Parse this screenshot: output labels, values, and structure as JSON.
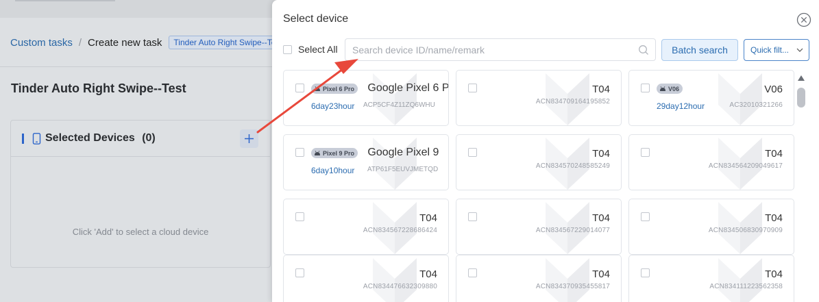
{
  "breadcrumb": {
    "parent": "Custom tasks",
    "separator": "/",
    "current": "Create new task",
    "tag": "Tinder Auto Right Swipe--Te"
  },
  "task": {
    "title": "Tinder Auto Right Swipe--Test"
  },
  "panel": {
    "title": "Selected Devices",
    "count": "(0)",
    "empty_text": "Click 'Add' to select a cloud device"
  },
  "dialog": {
    "title": "Select device",
    "select_all": "Select All",
    "search_placeholder": "Search device ID/name/remark",
    "search_value": "",
    "batch_search": "Batch search",
    "quick_filter": "Quick filt..."
  },
  "devices": [
    {
      "badge": "Pixel 6 Pro",
      "model": "Google Pixel 6 P",
      "uptime": "6day23hour",
      "serial": "ACP5CF4Z11ZQ6WHU"
    },
    {
      "model": "T04",
      "serial": "ACN834709164195852"
    },
    {
      "badge": "V06",
      "model": "V06",
      "uptime": "29day12hour",
      "serial": "AC32010321266"
    },
    {
      "badge": "Pixel 9 Pro",
      "model": "Google Pixel 9",
      "uptime": "6day10hour",
      "serial": "ATP61F5EUVJMETQD"
    },
    {
      "model": "T04",
      "serial": "ACN834570248585249"
    },
    {
      "model": "T04",
      "serial": "ACN834564209049617"
    },
    {
      "model": "T04",
      "serial": "ACN834567228686424"
    },
    {
      "model": "T04",
      "serial": "ACN834567229014077"
    },
    {
      "model": "T04",
      "serial": "ACN834506830970909"
    },
    {
      "model": "T04",
      "serial": "ACN834476632309880"
    },
    {
      "model": "T04",
      "serial": "ACN834370935455817"
    },
    {
      "model": "T04",
      "serial": "ACN834111223562358"
    }
  ],
  "colors": {
    "accent": "#2b6cb0",
    "annotation_arrow": "#e8483b"
  },
  "icons": [
    "phone-icon",
    "add-icon",
    "close-icon",
    "search-icon",
    "chevron-down-icon",
    "scroll-up-icon",
    "android-icon"
  ]
}
